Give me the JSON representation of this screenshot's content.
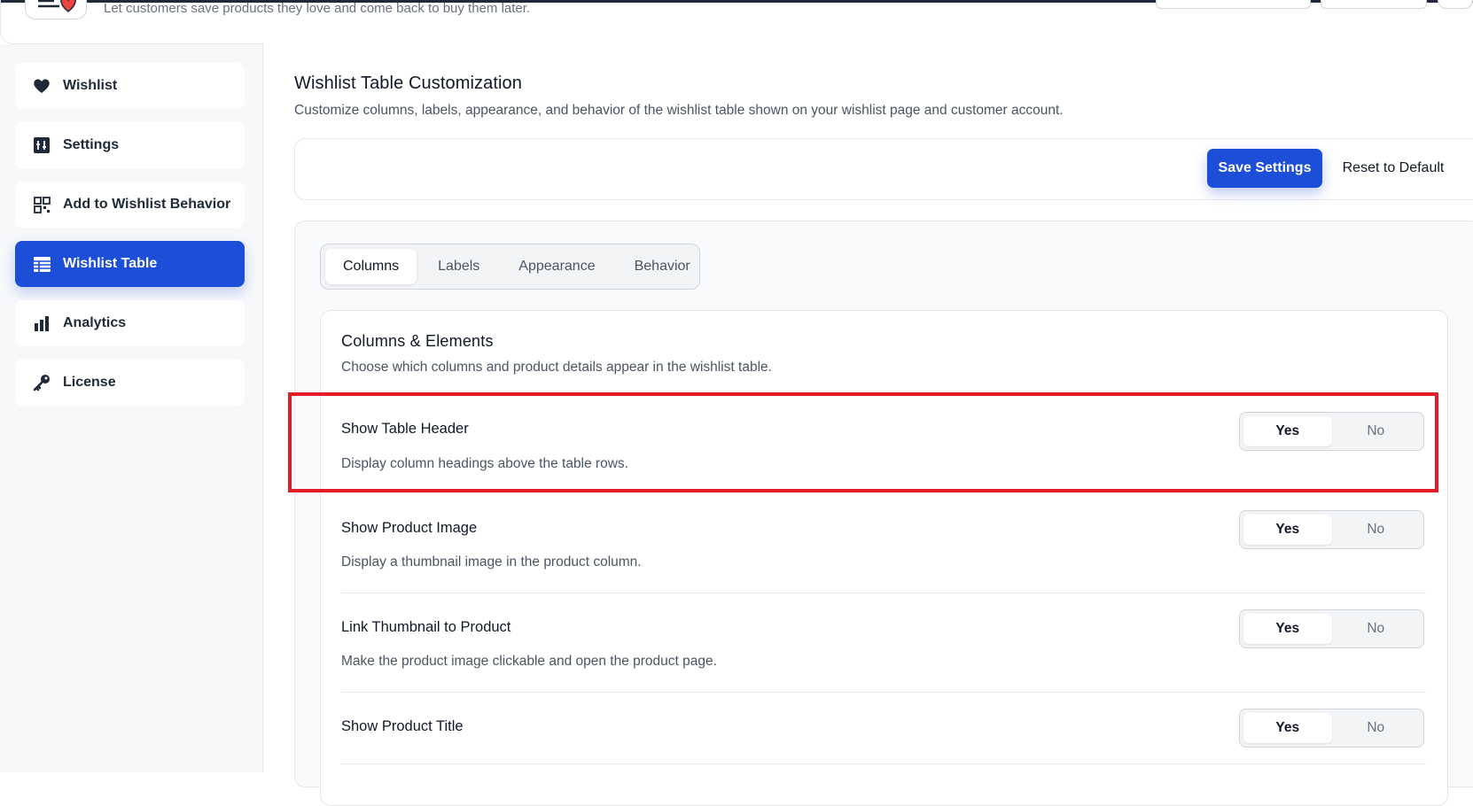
{
  "header": {
    "description": "Let customers save products they love and come back to buy them later."
  },
  "sidebar": {
    "items": [
      {
        "label": "Wishlist",
        "icon": "heart-icon"
      },
      {
        "label": "Settings",
        "icon": "settings-icon"
      },
      {
        "label": "Add to Wishlist Behavior",
        "icon": "qr-grid-icon"
      },
      {
        "label": "Wishlist Table",
        "icon": "table-icon",
        "active": true
      },
      {
        "label": "Analytics",
        "icon": "bar-chart-icon"
      },
      {
        "label": "License",
        "icon": "key-icon"
      }
    ]
  },
  "page": {
    "title": "Wishlist Table Customization",
    "description": "Customize columns, labels, appearance, and behavior of the wishlist table shown on your wishlist page and customer account."
  },
  "actions": {
    "save_label": "Save Settings",
    "reset_label": "Reset to Default"
  },
  "tabs": [
    {
      "label": "Columns",
      "active": true
    },
    {
      "label": "Labels"
    },
    {
      "label": "Appearance"
    },
    {
      "label": "Behavior"
    }
  ],
  "section": {
    "title": "Columns & Elements",
    "description": "Choose which columns and product details appear in the wishlist table.",
    "rows": [
      {
        "title": "Show Table Header",
        "description": "Display column headings above the table rows.",
        "yes": "Yes",
        "no": "No",
        "value": "Yes"
      },
      {
        "title": "Show Product Image",
        "description": "Display a thumbnail image in the product column.",
        "yes": "Yes",
        "no": "No",
        "value": "Yes"
      },
      {
        "title": "Link Thumbnail to Product",
        "description": "Make the product image clickable and open the product page.",
        "yes": "Yes",
        "no": "No",
        "value": "Yes"
      },
      {
        "title": "Show Product Title",
        "description": "",
        "yes": "Yes",
        "no": "No",
        "value": "Yes"
      }
    ]
  },
  "colors": {
    "accent": "#1d4ed8",
    "highlight": "#e11d28"
  }
}
